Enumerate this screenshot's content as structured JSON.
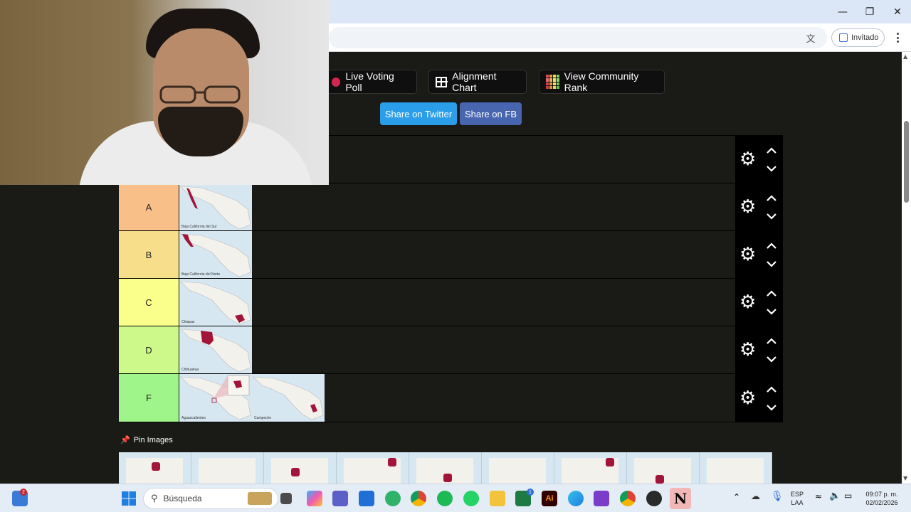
{
  "browser": {
    "window_controls": [
      "minimize",
      "restore",
      "close"
    ],
    "profile_label": "Invitado",
    "menu": "more-vertical"
  },
  "toolbar_buttons": {
    "live_voting": "Live Voting Poll",
    "alignment_chart": "Alignment Chart",
    "community_rank": "View Community Rank"
  },
  "share": {
    "twitter": "Share on Twitter",
    "facebook": "Share on FB",
    "twitter_color": "#2a9ee8",
    "facebook_color": "#4866b0"
  },
  "tiers": [
    {
      "label": "",
      "color": "#1a1a17",
      "items": []
    },
    {
      "label": "A",
      "color": "#f9bf89",
      "items": [
        {
          "caption": "Baja California del Sur"
        }
      ]
    },
    {
      "label": "B",
      "color": "#f7de8a",
      "items": [
        {
          "caption": "Baja California del Norte"
        }
      ]
    },
    {
      "label": "C",
      "color": "#fafe8b",
      "items": [
        {
          "caption": "Chiapas"
        }
      ]
    },
    {
      "label": "D",
      "color": "#ccf98a",
      "items": [
        {
          "caption": "Chihuahua"
        }
      ]
    },
    {
      "label": "F",
      "color": "#9ff58a",
      "items": [
        {
          "caption": "Aguascalientes"
        },
        {
          "caption": "Campeche"
        }
      ]
    }
  ],
  "pin": {
    "label": "Pin Images"
  },
  "taskbar": {
    "search_placeholder": "Búsqueda",
    "widgets_badge": "2",
    "excel_badge": "1",
    "lang_top": "ESP",
    "lang_bottom": "LAA",
    "time": "09:07 p. m.",
    "date": "02/02/2026"
  }
}
